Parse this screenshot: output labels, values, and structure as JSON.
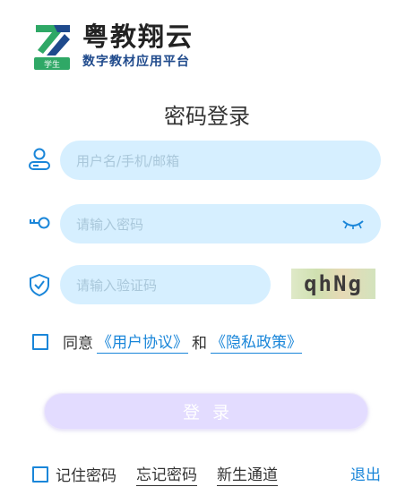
{
  "brand": {
    "title": "粤教翔云",
    "subtitle": "数字教材应用平台",
    "badge": "学生",
    "colors": {
      "green": "#2fa866",
      "navy": "#1f4a8c"
    }
  },
  "page_title": "密码登录",
  "form": {
    "username_placeholder": "用户名/手机/邮箱",
    "password_placeholder": "请输入密码",
    "captcha_placeholder": "请输入验证码",
    "captcha_text": "qhNg"
  },
  "agreement": {
    "prefix": "同意",
    "user_agreement": "《用户协议》",
    "joiner": "和",
    "privacy_policy": "《隐私政策》",
    "checked": false
  },
  "login_button": "登录",
  "footer": {
    "remember": "记住密码",
    "forgot": "忘记密码",
    "new_student": "新生通道",
    "exit": "退出"
  },
  "icons": {
    "user": "user-icon",
    "key": "key-icon",
    "shield": "shield-check-icon",
    "eye": "eye-closed-icon"
  },
  "accent_color": "#1a86d9"
}
